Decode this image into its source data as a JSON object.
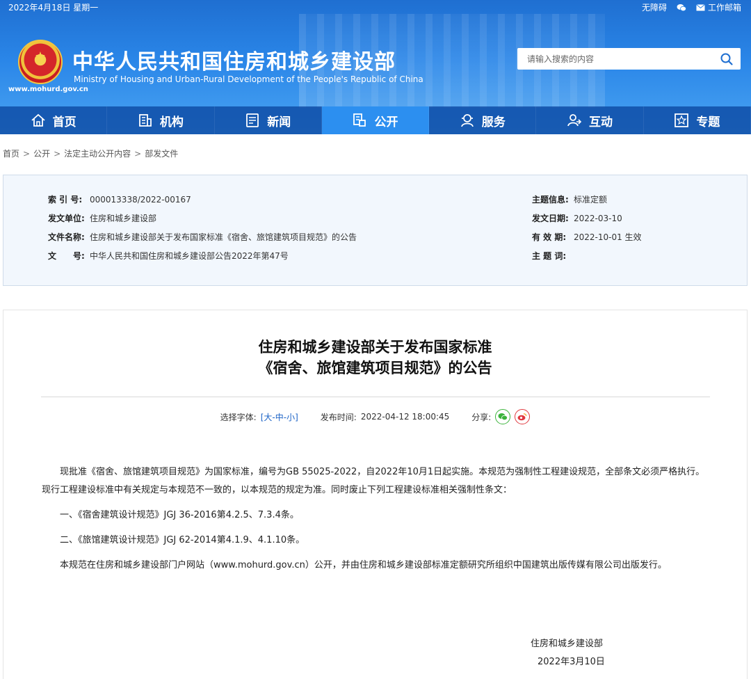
{
  "topbar": {
    "date": "2022年4月18日 星期一",
    "accessibility": "无障碍",
    "mail": "工作邮箱"
  },
  "site": {
    "title": "中华人民共和国住房和城乡建设部",
    "subtitle": "Ministry of Housing and Urban-Rural Development of the People's Republic of China",
    "url": "www.mohurd.gov.cn"
  },
  "search": {
    "placeholder": "请输入搜索的内容"
  },
  "nav": [
    {
      "label": "首页",
      "icon": "home-icon"
    },
    {
      "label": "机构",
      "icon": "building-icon"
    },
    {
      "label": "新闻",
      "icon": "news-icon"
    },
    {
      "label": "公开",
      "icon": "disclosure-icon",
      "active": true
    },
    {
      "label": "服务",
      "icon": "service-icon"
    },
    {
      "label": "互动",
      "icon": "interaction-icon"
    },
    {
      "label": "专题",
      "icon": "topic-icon"
    }
  ],
  "breadcrumb": [
    "首页",
    "公开",
    "法定主动公开内容",
    "部发文件"
  ],
  "info": {
    "index_label": "索 引 号:",
    "index_value": "000013338/2022-00167",
    "issuer_label": "发文单位:",
    "issuer_value": "住房和城乡建设部",
    "docname_label": "文件名称:",
    "docname_value": "住房和城乡建设部关于发布国家标准《宿舍、旅馆建筑项目规范》的公告",
    "docno_label": "文　　号:",
    "docno_value": "中华人民共和国住房和城乡建设部公告2022年第47号",
    "topic_label": "主题信息:",
    "topic_value": "标准定额",
    "date_label": "发文日期:",
    "date_value": "2022-03-10",
    "validity_label": "有 效 期:",
    "validity_value": "2022-10-01 生效",
    "keywords_label": "主 题 词:",
    "keywords_value": ""
  },
  "article": {
    "title_line1": "住房和城乡建设部关于发布国家标准",
    "title_line2": "《宿舍、旅馆建筑项目规范》的公告",
    "font_label": "选择字体:",
    "font_bracket_open": "[",
    "font_large": "大",
    "font_medium": "中",
    "font_small": "小",
    "font_bracket_close": "]",
    "dash": "-",
    "publish_label": "发布时间:",
    "publish_time": "2022-04-12 18:00:45",
    "share_label": "分享:",
    "p1": "现批准《宿舍、旅馆建筑项目规范》为国家标准，编号为GB 55025-2022，自2022年10月1日起实施。本规范为强制性工程建设规范，全部条文必须严格执行。现行工程建设标准中有关规定与本规范不一致的，以本规范的规定为准。同时废止下列工程建设标准相关强制性条文：",
    "p2": "一、《宿舍建筑设计规范》JGJ 36-2016第4.2.5、7.3.4条。",
    "p3": "二、《旅馆建筑设计规范》JGJ 62-2014第4.1.9、4.1.10条。",
    "p4": "本规范在住房和城乡建设部门户网站（www.mohurd.gov.cn）公开，并由住房和城乡建设部标准定额研究所组织中国建筑出版传媒有限公司出版发行。",
    "sign_org": "住房和城乡建设部",
    "sign_date": "2022年3月10日"
  },
  "colors": {
    "header_blue": "#2a86e8",
    "nav_active": "#2c8ff0",
    "link_blue": "#1a62c6",
    "wechat_green": "#3bb33b",
    "weibo_red": "#e0383e"
  }
}
